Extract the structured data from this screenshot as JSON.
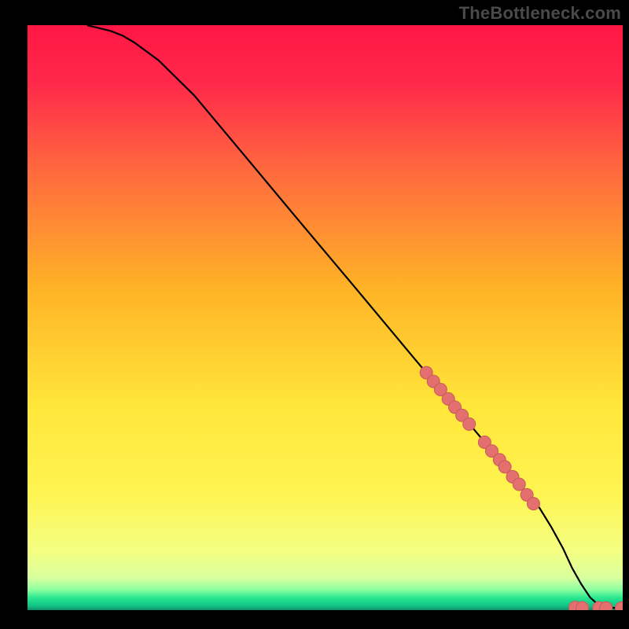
{
  "watermark": "TheBottleneck.com",
  "chart_data": {
    "type": "line",
    "title": "",
    "xlabel": "",
    "ylabel": "",
    "xlim": [
      0,
      100
    ],
    "ylim": [
      0,
      100
    ],
    "grid": false,
    "legend": false,
    "background_gradient": {
      "stops": [
        {
          "t": 0.0,
          "color": "#ff1744"
        },
        {
          "t": 0.1,
          "color": "#ff294a"
        },
        {
          "t": 0.25,
          "color": "#ff6a3e"
        },
        {
          "t": 0.45,
          "color": "#ffb326"
        },
        {
          "t": 0.65,
          "color": "#ffe63a"
        },
        {
          "t": 0.8,
          "color": "#fff451"
        },
        {
          "t": 0.9,
          "color": "#f4ff82"
        },
        {
          "t": 0.945,
          "color": "#d8ff9e"
        },
        {
          "t": 0.965,
          "color": "#8effa0"
        },
        {
          "t": 0.978,
          "color": "#2fe890"
        },
        {
          "t": 0.986,
          "color": "#19d68c"
        },
        {
          "t": 0.993,
          "color": "#13c085"
        },
        {
          "t": 1.0,
          "color": "#0f8f6b"
        }
      ]
    },
    "series": [
      {
        "name": "curve",
        "stroke": "#000000",
        "x": [
          10,
          12,
          14,
          16,
          18,
          22,
          28,
          35,
          45,
          55,
          65,
          75,
          82,
          86,
          88,
          90,
          91.5,
          93,
          94.5,
          96,
          98,
          100
        ],
        "values": [
          100,
          99.5,
          99.0,
          98.2,
          97.0,
          94.0,
          88.0,
          79.5,
          67.3,
          55.2,
          43.0,
          30.9,
          22.4,
          17.5,
          14.2,
          10.5,
          7.2,
          4.5,
          2.2,
          0.8,
          0.4,
          0.35
        ]
      }
    ],
    "markers": {
      "name": "highlight-dots",
      "color": "#e46f6f",
      "stroke": "#c95a5a",
      "radius": 8,
      "points": [
        {
          "x": 67.0,
          "y": 40.6
        },
        {
          "x": 68.2,
          "y": 39.1
        },
        {
          "x": 69.4,
          "y": 37.7
        },
        {
          "x": 70.7,
          "y": 36.1
        },
        {
          "x": 71.8,
          "y": 34.7
        },
        {
          "x": 73.0,
          "y": 33.3
        },
        {
          "x": 74.2,
          "y": 31.8
        },
        {
          "x": 76.8,
          "y": 28.7
        },
        {
          "x": 78.0,
          "y": 27.2
        },
        {
          "x": 79.3,
          "y": 25.7
        },
        {
          "x": 80.2,
          "y": 24.5
        },
        {
          "x": 81.5,
          "y": 22.8
        },
        {
          "x": 82.6,
          "y": 21.5
        },
        {
          "x": 83.9,
          "y": 19.7
        },
        {
          "x": 85.0,
          "y": 18.2
        },
        {
          "x": 92.0,
          "y": 0.45
        },
        {
          "x": 93.2,
          "y": 0.4
        },
        {
          "x": 96.0,
          "y": 0.38
        },
        {
          "x": 97.2,
          "y": 0.37
        },
        {
          "x": 99.8,
          "y": 0.35
        }
      ]
    }
  }
}
